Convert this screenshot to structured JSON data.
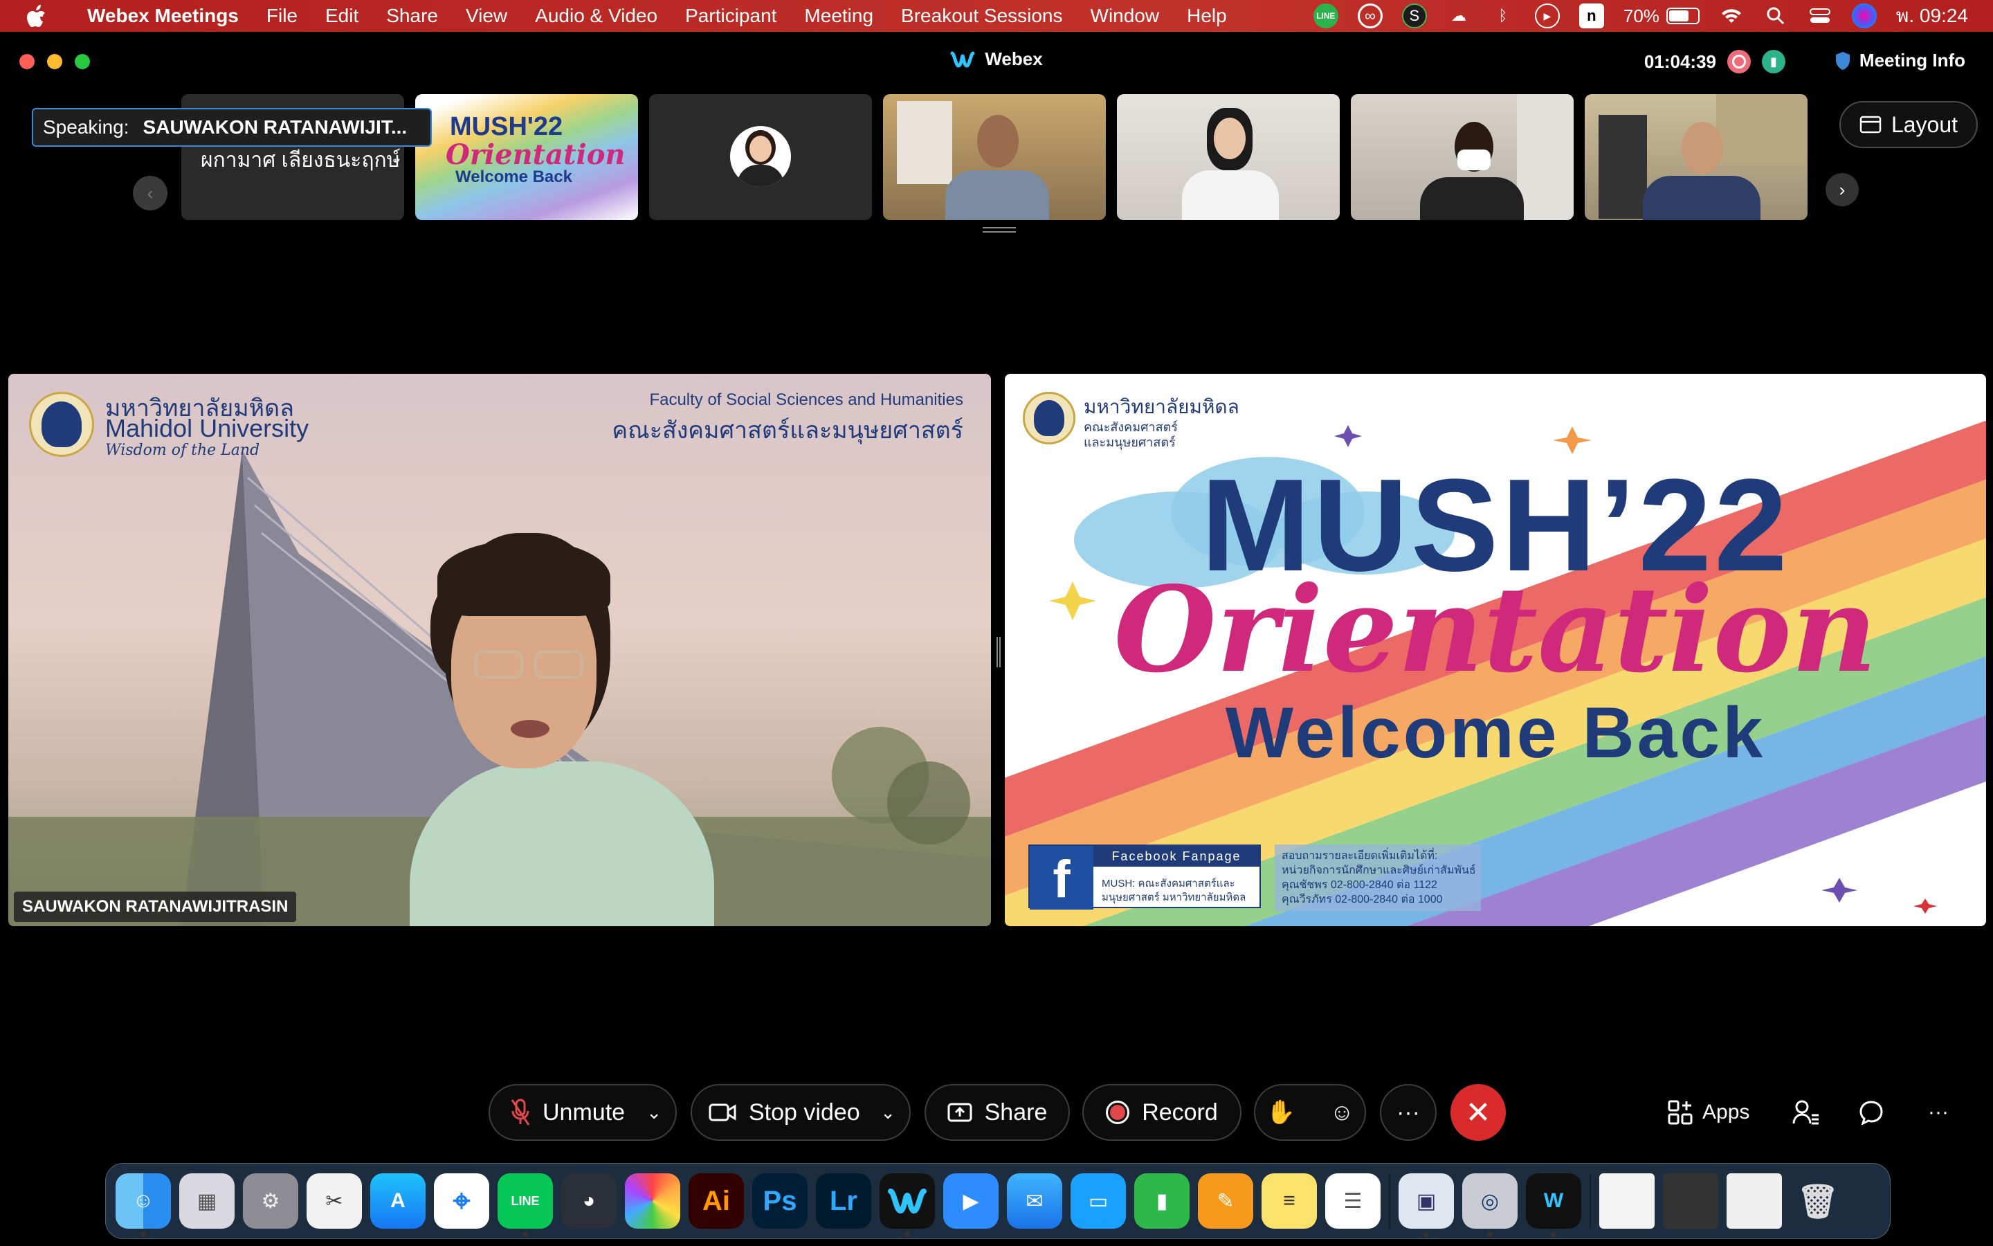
{
  "menubar": {
    "app": "Webex Meetings",
    "items": [
      "File",
      "Edit",
      "Share",
      "View",
      "Audio & Video",
      "Participant",
      "Meeting",
      "Breakout Sessions",
      "Window",
      "Help"
    ],
    "status": {
      "line": "LINE",
      "battery_pct": "70%",
      "battery_level": 0.7,
      "clock": "พ. 09:24"
    }
  },
  "window": {
    "title": "Webex",
    "timer": "01:04:39",
    "meeting_info": "Meeting Info"
  },
  "filmstrip": {
    "speaking_label": "Speaking:",
    "speaking_name": "SAUWAKON RATANAWIJIT...",
    "tile1_name": "ผกามาศ เลียงธนะฤกษ์",
    "tile2_l1": "MUSH'22",
    "tile2_l2": "Orientation",
    "tile2_l3": "Welcome Back",
    "layout_label": "Layout"
  },
  "left_stage": {
    "uni_thai": "มหาวิทยาลัยมหิดล",
    "uni_en": "Mahidol University",
    "motto": "Wisdom of the Land",
    "faculty_en": "Faculty of Social Sciences and Humanities",
    "faculty_th": "คณะสังคมศาสตร์และมนุษยศาสตร์",
    "caption": "SAUWAKON RATANAWIJITRASIN"
  },
  "right_stage": {
    "uni_thai": "มหาวิทยาลัยมหิดล",
    "fac_l1": "คณะสังคมศาสตร์",
    "fac_l2": "และมนุษยศาสตร์",
    "headline": "MUSH’22",
    "script": "Orientation",
    "sub": "Welcome Back",
    "fb_title": "Facebook Fanpage",
    "fb_l1": "MUSH: คณะสังคมศาสตร์และ",
    "fb_l2": "มนุษยศาสตร์ มหาวิทยาลัยมหิดล",
    "info_l1": "สอบถามรายละเอียดเพิ่มเติมได้ที่:",
    "info_l2": "หน่วยกิจการนักศึกษาและศิษย์เก่าสัมพันธ์",
    "info_l3": "คุณชัชพร   02-800-2840 ต่อ 1122",
    "info_l4": "คุณวีรภัทร   02-800-2840 ต่อ 1000"
  },
  "controls": {
    "unmute": "Unmute",
    "stop_video": "Stop video",
    "share": "Share",
    "record": "Record",
    "more": "···",
    "apps": "Apps",
    "overflow": "···"
  },
  "dock": {
    "line": "LINE",
    "ai": "Ai",
    "ps": "Ps",
    "lr": "Lr"
  }
}
